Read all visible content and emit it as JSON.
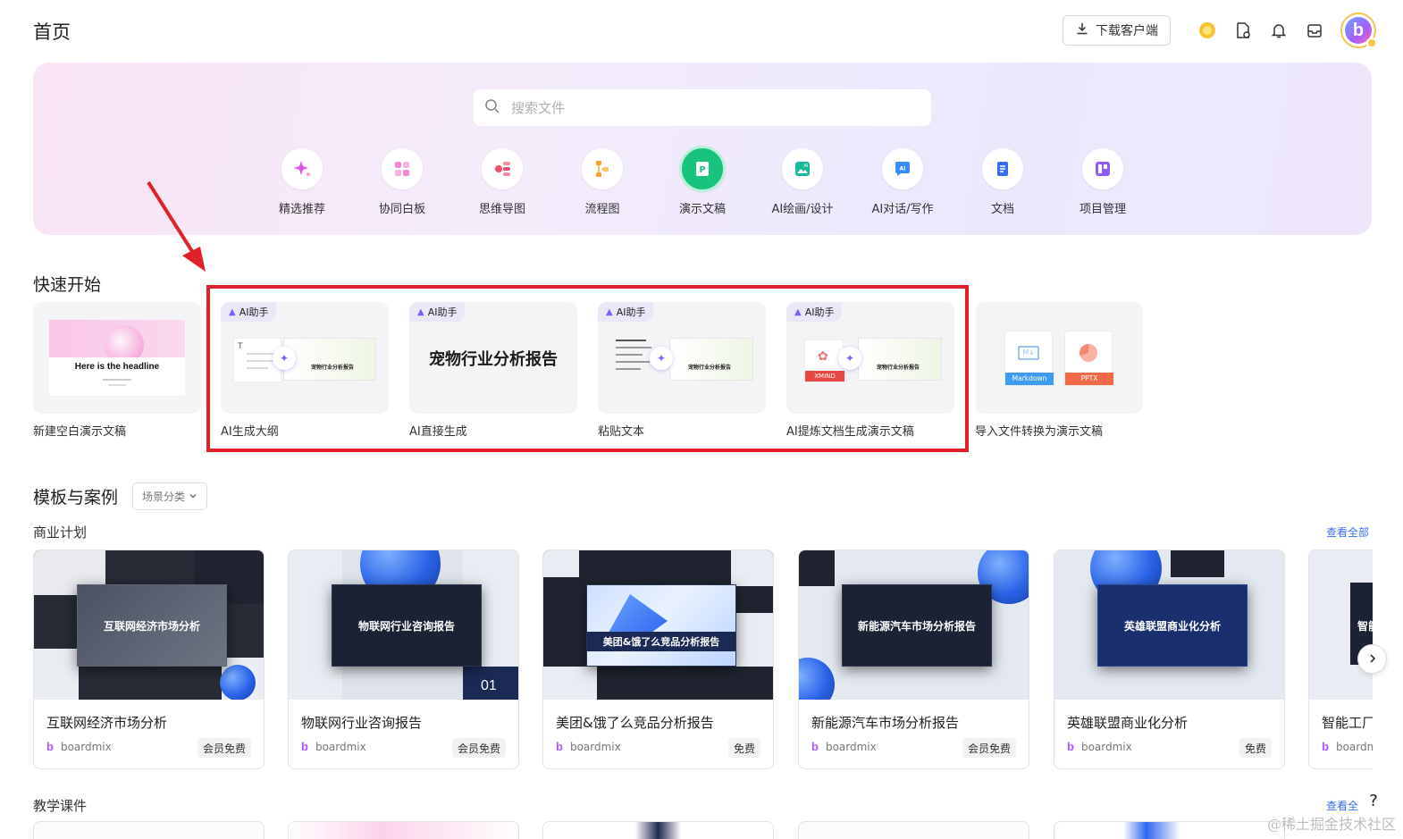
{
  "header": {
    "title": "首页",
    "download_label": "下载客户端"
  },
  "search": {
    "placeholder": "搜索文件"
  },
  "categories": [
    {
      "label": "精选推荐",
      "icon": "sparkle-icon"
    },
    {
      "label": "协同白板",
      "icon": "whiteboard-icon"
    },
    {
      "label": "思维导图",
      "icon": "mindmap-icon"
    },
    {
      "label": "流程图",
      "icon": "flowchart-icon"
    },
    {
      "label": "演示文稿",
      "icon": "presentation-icon",
      "active": true
    },
    {
      "label": "AI绘画/设计",
      "icon": "ai-paint-icon"
    },
    {
      "label": "AI对话/写作",
      "icon": "ai-chat-icon"
    },
    {
      "label": "文档",
      "icon": "document-icon"
    },
    {
      "label": "项目管理",
      "icon": "project-icon"
    }
  ],
  "quick_start": {
    "title": "快速开始",
    "ai_tag": "AI助手",
    "blank": {
      "label": "新建空白演示文稿",
      "headline": "Here is the headline"
    },
    "ai_outline": {
      "label": "AI生成大纲",
      "slide_title": "宠物行业分析报告"
    },
    "ai_direct": {
      "label": "AI直接生成",
      "big_title": "宠物行业分析报告"
    },
    "paste_text": {
      "label": "粘贴文本",
      "slide_title": "宠物行业分析报告"
    },
    "ai_extract": {
      "label": "AI提炼文档生成演示文稿",
      "slide_title": "宠物行业分析报告",
      "badge": "XMIND"
    },
    "import": {
      "label": "导入文件转换为演示文稿",
      "badge_md": "Markdown",
      "badge_pptx": "PPTX"
    }
  },
  "templates": {
    "title": "模板与案例",
    "scene_filter": "场景分类",
    "business": {
      "title": "商业计划",
      "view_all": "查看全部",
      "cards": [
        {
          "name": "互联网经济市场分析",
          "author": "boardmix",
          "tag": "会员免费",
          "thumb_title": "互联网经济市场分析"
        },
        {
          "name": "物联网行业咨询报告",
          "author": "boardmix",
          "tag": "会员免费",
          "thumb_title": "物联网行业咨询报告",
          "thumb_num": "01"
        },
        {
          "name": "美团&饿了么竞品分析报告",
          "author": "boardmix",
          "tag": "免费",
          "thumb_title": "美团&饿了么竞品分析报告"
        },
        {
          "name": "新能源汽车市场分析报告",
          "author": "boardmix",
          "tag": "会员免费",
          "thumb_title": "新能源汽车市场分析报告"
        },
        {
          "name": "英雄联盟商业化分析",
          "author": "boardmix",
          "tag": "免费",
          "thumb_title": "英雄联盟商业化分析"
        },
        {
          "name": "智能工厂",
          "author": "boardmix",
          "tag": "",
          "thumb_title": "智能"
        }
      ]
    },
    "teaching": {
      "title": "教学课件",
      "view_all": "查看全部"
    }
  },
  "watermark": "@稀土掘金技术社区",
  "colors": {
    "accent": "#3a6cf0",
    "active": "#19c37d",
    "annotation": "#e0202a",
    "brand": "#a857ff"
  }
}
